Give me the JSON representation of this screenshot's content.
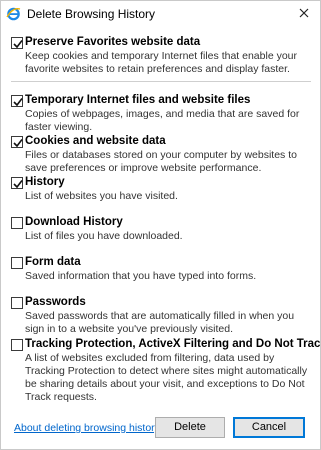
{
  "window": {
    "title": "Delete Browsing History",
    "app_icon": "ie-icon",
    "close_icon": "close-icon"
  },
  "options": [
    {
      "title": "Preserve Favorites website data",
      "checked": true,
      "description": "Keep cookies and temporary Internet files that enable your favorite websites to retain preferences and display faster."
    },
    {
      "title": "Temporary Internet files and website files",
      "checked": true,
      "description": "Copies of webpages, images, and media that are saved for faster viewing."
    },
    {
      "title": "Cookies and website data",
      "checked": true,
      "description": "Files or databases stored on your computer by websites to save preferences or improve website performance."
    },
    {
      "title": "History",
      "checked": true,
      "description": "List of websites you have visited."
    },
    {
      "title": "Download History",
      "checked": false,
      "description": "List of files you have downloaded."
    },
    {
      "title": "Form data",
      "checked": false,
      "description": "Saved information that you have typed into forms."
    },
    {
      "title": "Passwords",
      "checked": false,
      "description": "Saved passwords that are automatically filled in when you sign in to a website you've previously visited."
    },
    {
      "title": "Tracking Protection, ActiveX Filtering and Do Not Track",
      "checked": false,
      "description": "A list of websites excluded from filtering, data used by Tracking Protection to detect where sites might automatically be sharing details about your visit, and exceptions to Do Not Track requests."
    }
  ],
  "footer": {
    "about_link": "About deleting browsing history",
    "delete_label": "Delete",
    "cancel_label": "Cancel"
  },
  "colors": {
    "link": "#0066cc",
    "focus_border": "#0078d7"
  }
}
